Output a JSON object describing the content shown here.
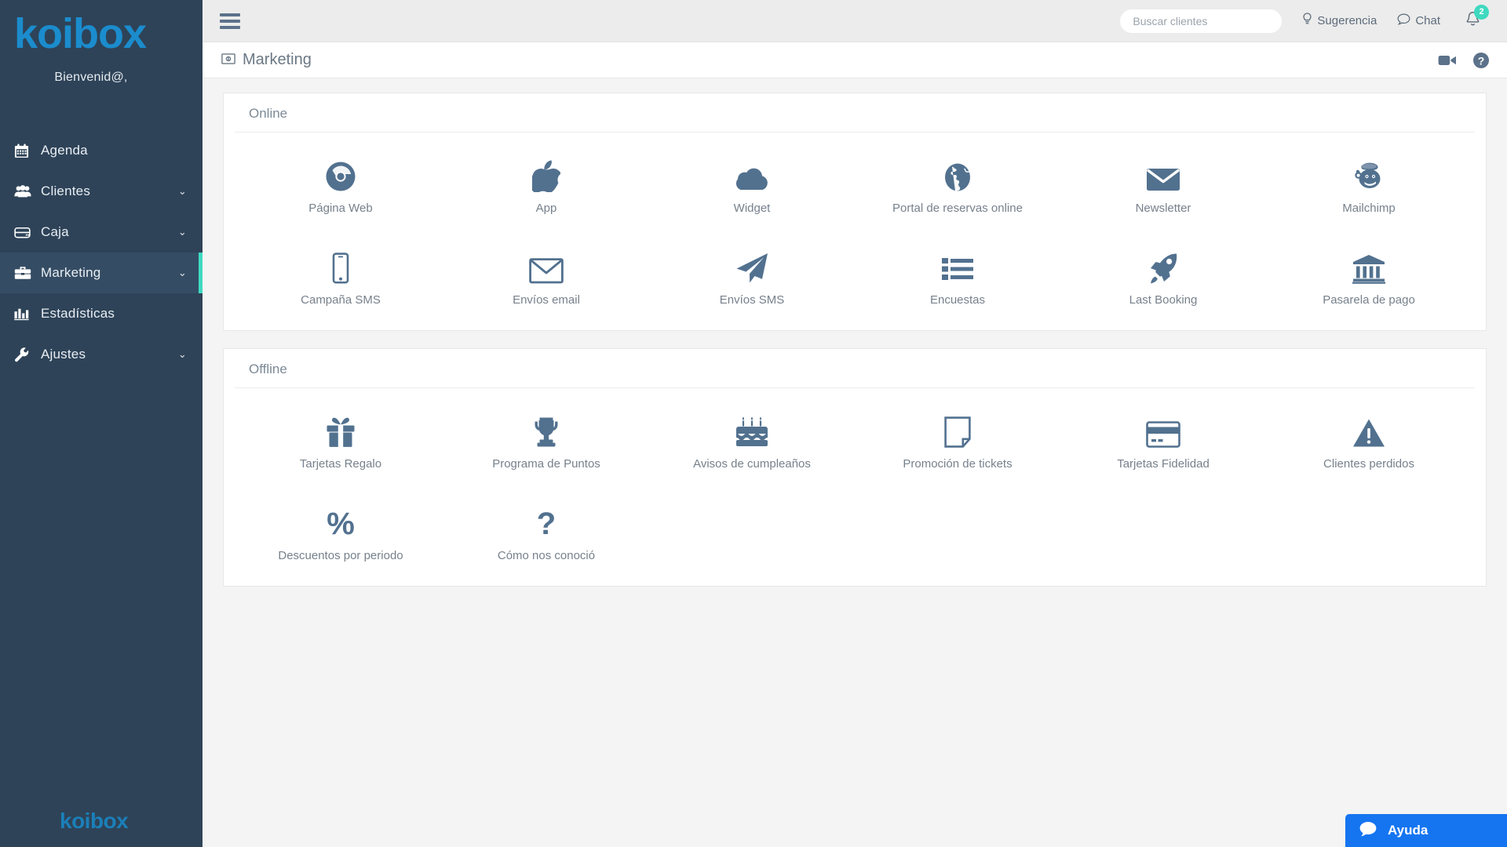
{
  "brand": {
    "logo_text": "koibox",
    "footer_logo_text": "koibox"
  },
  "sidebar": {
    "welcome": "Bienvenid@,",
    "items": [
      {
        "label": "Agenda",
        "icon": "calendar-icon",
        "caret": "",
        "active": false
      },
      {
        "label": "Clientes",
        "icon": "users-icon",
        "caret": "⌄",
        "active": false
      },
      {
        "label": "Caja",
        "icon": "cash-register-icon",
        "caret": "⌄",
        "active": false
      },
      {
        "label": "Marketing",
        "icon": "briefcase-icon",
        "caret": "⌄",
        "active": true
      },
      {
        "label": "Estadísticas",
        "icon": "bar-chart-icon",
        "caret": "",
        "active": false
      },
      {
        "label": "Ajustes",
        "icon": "wrench-icon",
        "caret": "⌄",
        "active": false
      }
    ]
  },
  "topbar": {
    "menu_toggle": "hamburger-icon",
    "search": {
      "placeholder": "Buscar clientes",
      "value": ""
    },
    "suggestion_label": "Sugerencia",
    "chat_label": "Chat",
    "notifications_count": "2"
  },
  "pagebar": {
    "title": "Marketing",
    "title_icon": "money-bill-icon",
    "video_icon": "video-camera-icon",
    "help_icon": "question-circle-icon"
  },
  "sections": [
    {
      "title": "Online",
      "tiles": [
        {
          "label": "Página Web",
          "icon": "chrome-icon"
        },
        {
          "label": "App",
          "icon": "apple-icon"
        },
        {
          "label": "Widget",
          "icon": "cloud-icon"
        },
        {
          "label": "Portal de reservas online",
          "icon": "globe-icon"
        },
        {
          "label": "Newsletter",
          "icon": "envelope-solid-icon"
        },
        {
          "label": "Mailchimp",
          "icon": "mailchimp-icon"
        },
        {
          "label": "Campaña SMS",
          "icon": "mobile-phone-icon"
        },
        {
          "label": "Envíos email",
          "icon": "envelope-outline-icon"
        },
        {
          "label": "Envíos SMS",
          "icon": "paper-plane-icon"
        },
        {
          "label": "Encuestas",
          "icon": "list-icon"
        },
        {
          "label": "Last Booking",
          "icon": "rocket-icon"
        },
        {
          "label": "Pasarela de pago",
          "icon": "bank-icon"
        }
      ]
    },
    {
      "title": "Offline",
      "tiles": [
        {
          "label": "Tarjetas Regalo",
          "icon": "gift-icon"
        },
        {
          "label": "Programa de Puntos",
          "icon": "trophy-icon"
        },
        {
          "label": "Avisos de cumpleaños",
          "icon": "birthday-cake-icon"
        },
        {
          "label": "Promoción de tickets",
          "icon": "file-icon"
        },
        {
          "label": "Tarjetas Fidelidad",
          "icon": "credit-card-icon"
        },
        {
          "label": "Clientes perdidos",
          "icon": "warning-triangle-icon"
        },
        {
          "label": "Descuentos por periodo",
          "icon": "percent-icon"
        },
        {
          "label": "Cómo nos conoció",
          "icon": "question-mark-icon"
        }
      ]
    }
  ],
  "help_widget": {
    "label": "Ayuda",
    "icon": "chat-bubble-icon"
  },
  "colors": {
    "sidebar_bg": "#2e4358",
    "sidebar_active_bg": "#354d64",
    "accent_teal": "#3fd9bf",
    "brand_blue": "#1b8ccd",
    "icon_blue": "#52718f",
    "help_blue": "#1575f0",
    "text_gray": "#77818c"
  }
}
